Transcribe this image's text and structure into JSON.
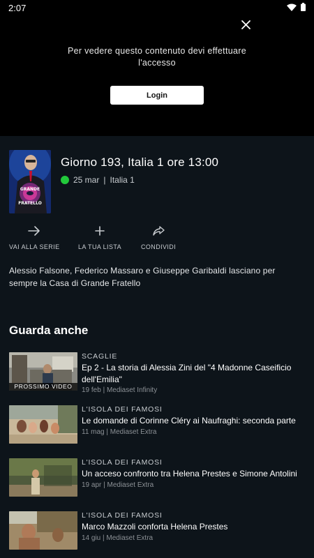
{
  "status_bar": {
    "time": "2:07"
  },
  "player": {
    "message": "Per vedere questo contenuto devi effettuare l'accesso",
    "login_label": "Login"
  },
  "episode": {
    "poster_text": "GRANDE FRATELLO",
    "title": "Giorno 193, Italia 1 ore 13:00",
    "date": "25 mar",
    "separator": "|",
    "channel": "Italia 1",
    "live_dot_color": "#22c93b",
    "description": "Alessio Falsone, Federico Massaro e Giuseppe Garibaldi lasciano per sempre la Casa di Grande Fratello"
  },
  "actions": [
    {
      "label": "VAI ALLA SERIE",
      "icon": "arrow-right-icon"
    },
    {
      "label": "LA TUA LISTA",
      "icon": "plus-icon"
    },
    {
      "label": "CONDIVIDI",
      "icon": "share-icon"
    }
  ],
  "section": {
    "title": "Guarda anche"
  },
  "related": [
    {
      "show": "SCAGLIE",
      "title": "Ep 2 - La storia di Alessia Zini del \"4 Madonne Caseificio dell'Emilia\"",
      "meta": "19 feb | Mediaset Infinity",
      "tag": "PROSSIMO VIDEO"
    },
    {
      "show": "L'ISOLA DEI FAMOSI",
      "title": "Le domande di Corinne Cléry ai Naufraghi: seconda parte",
      "meta": "11 mag | Mediaset Extra"
    },
    {
      "show": "L'ISOLA DEI FAMOSI",
      "title": "Un acceso confronto tra Helena Prestes e Simone Antolini",
      "meta": "19 apr | Mediaset Extra"
    },
    {
      "show": "L'ISOLA DEI FAMOSI",
      "title": "Marco Mazzoli conforta Helena Prestes",
      "meta": "14 giu | Mediaset Extra"
    }
  ]
}
